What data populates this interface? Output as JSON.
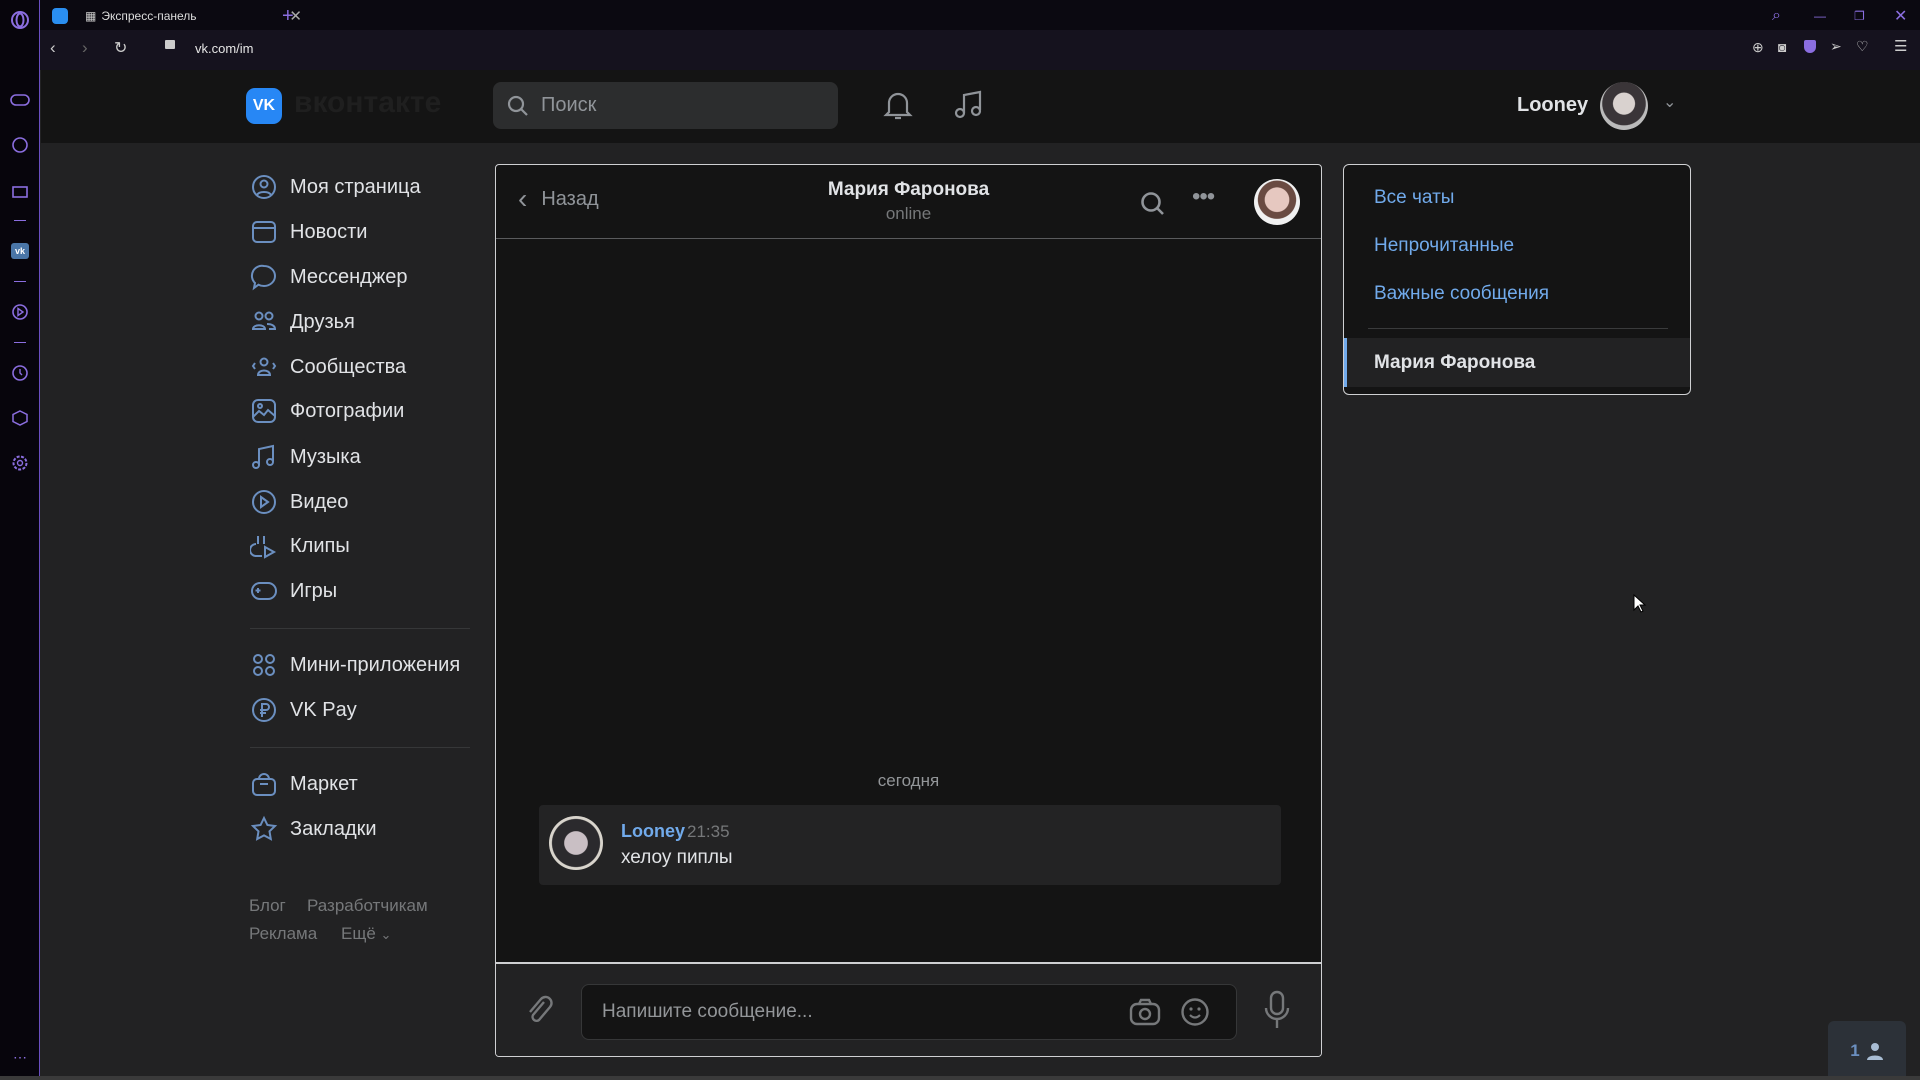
{
  "browser": {
    "tabs": [
      {
        "label": "Экспресс-панель"
      }
    ],
    "url": "vk.com/im"
  },
  "header": {
    "logo_text": "вконтакте",
    "search_placeholder": "Поиск",
    "user_name": "Looney"
  },
  "nav": {
    "items": [
      {
        "label": "Моя страница",
        "icon": "user-circle-icon"
      },
      {
        "label": "Новости",
        "icon": "news-icon"
      },
      {
        "label": "Мессенджер",
        "icon": "message-icon"
      },
      {
        "label": "Друзья",
        "icon": "friends-icon"
      },
      {
        "label": "Сообщества",
        "icon": "communities-icon"
      },
      {
        "label": "Фотографии",
        "icon": "photo-icon"
      },
      {
        "label": "Музыка",
        "icon": "music-icon"
      },
      {
        "label": "Видео",
        "icon": "video-icon"
      },
      {
        "label": "Клипы",
        "icon": "clips-icon"
      },
      {
        "label": "Игры",
        "icon": "gamepad-icon"
      }
    ],
    "items2": [
      {
        "label": "Мини-приложения",
        "icon": "apps-icon"
      },
      {
        "label": "VK Pay",
        "icon": "ruble-icon"
      }
    ],
    "items3": [
      {
        "label": "Маркет",
        "icon": "bag-icon"
      },
      {
        "label": "Закладки",
        "icon": "star-icon"
      }
    ],
    "footer": {
      "blog": "Блог",
      "dev": "Разработчикам",
      "ads": "Реклама",
      "more": "Ещё"
    }
  },
  "chat": {
    "back": "Назад",
    "title": "Мария Фаронова",
    "status": "online",
    "date_sep": "сегодня",
    "messages": [
      {
        "author": "Looney",
        "time": "21:35",
        "text": "хелоу пиплы"
      }
    ],
    "input_placeholder": "Напишите сообщение..."
  },
  "right": {
    "all": "Все чаты",
    "unread": "Непрочитанные",
    "important": "Важные сообщения",
    "selected_chat": "Мария Фаронова"
  },
  "widget": {
    "count": "1"
  },
  "colors": {
    "accent": "#71aaeb",
    "opera": "#8b6ee0",
    "vk": "#2787f5"
  }
}
